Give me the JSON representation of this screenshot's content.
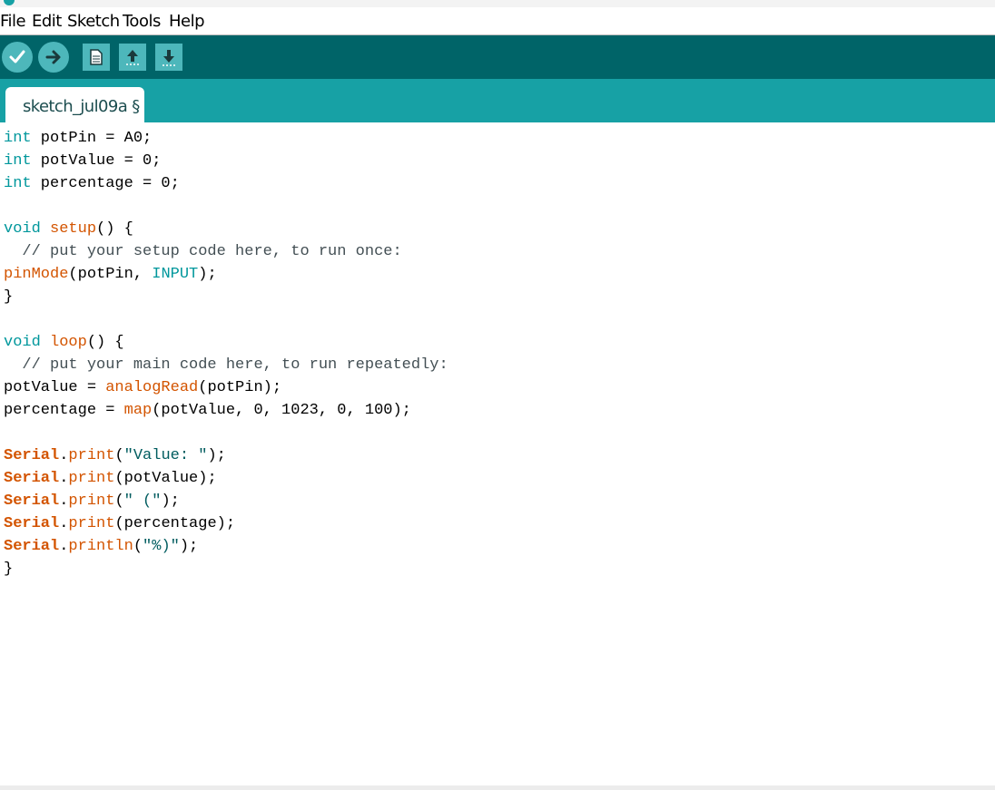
{
  "menu": {
    "items": [
      {
        "label": "File"
      },
      {
        "label": "Edit"
      },
      {
        "label": "Sketch"
      },
      {
        "label": "Tools"
      },
      {
        "label": "Help"
      }
    ]
  },
  "toolbar": {
    "buttons": [
      {
        "name": "verify",
        "icon": "check-icon"
      },
      {
        "name": "upload",
        "icon": "arrow-right-icon"
      },
      {
        "name": "new",
        "icon": "document-icon"
      },
      {
        "name": "open",
        "icon": "arrow-up-icon"
      },
      {
        "name": "save",
        "icon": "arrow-down-icon"
      }
    ]
  },
  "tab": {
    "label": "sketch_jul09a §"
  },
  "colors": {
    "toolbar_bg": "#006468",
    "tabstrip_bg": "#17a1a5",
    "button_bg": "#4db7bb",
    "keyword": "#00979c",
    "function": "#d35400",
    "comment": "#434f54"
  },
  "code": {
    "l1": [
      {
        "c": "kw",
        "t": "int"
      },
      {
        "c": "",
        "t": " potPin = A0;"
      }
    ],
    "l2": [
      {
        "c": "kw",
        "t": "int"
      },
      {
        "c": "",
        "t": " potValue = 0;"
      }
    ],
    "l3": [
      {
        "c": "kw",
        "t": "int"
      },
      {
        "c": "",
        "t": " percentage = 0;"
      }
    ],
    "l4": [
      {
        "c": "",
        "t": ""
      }
    ],
    "l5": [
      {
        "c": "kw",
        "t": "void"
      },
      {
        "c": "",
        "t": " "
      },
      {
        "c": "fn",
        "t": "setup"
      },
      {
        "c": "",
        "t": "() {"
      }
    ],
    "l6": [
      {
        "c": "cm",
        "t": "  // put your setup code here, to run once:"
      }
    ],
    "l7": [
      {
        "c": "fn",
        "t": "pinMode"
      },
      {
        "c": "",
        "t": "(potPin, "
      },
      {
        "c": "kw",
        "t": "INPUT"
      },
      {
        "c": "",
        "t": ");"
      }
    ],
    "l8": [
      {
        "c": "",
        "t": "}"
      }
    ],
    "l9": [
      {
        "c": "",
        "t": ""
      }
    ],
    "l10": [
      {
        "c": "kw",
        "t": "void"
      },
      {
        "c": "",
        "t": " "
      },
      {
        "c": "fn",
        "t": "loop"
      },
      {
        "c": "",
        "t": "() {"
      }
    ],
    "l11": [
      {
        "c": "cm",
        "t": "  // put your main code here, to run repeatedly:"
      }
    ],
    "l12": [
      {
        "c": "",
        "t": "potValue = "
      },
      {
        "c": "fn",
        "t": "analogRead"
      },
      {
        "c": "",
        "t": "(potPin);"
      }
    ],
    "l13": [
      {
        "c": "",
        "t": "percentage = "
      },
      {
        "c": "fn",
        "t": "map"
      },
      {
        "c": "",
        "t": "(potValue, 0, 1023, 0, 100);"
      }
    ],
    "l14": [
      {
        "c": "",
        "t": ""
      }
    ],
    "l15": [
      {
        "c": "ser",
        "t": "Serial"
      },
      {
        "c": "",
        "t": "."
      },
      {
        "c": "fn",
        "t": "print"
      },
      {
        "c": "",
        "t": "("
      },
      {
        "c": "str",
        "t": "\"Value: \""
      },
      {
        "c": "",
        "t": ");"
      }
    ],
    "l16": [
      {
        "c": "ser",
        "t": "Serial"
      },
      {
        "c": "",
        "t": "."
      },
      {
        "c": "fn",
        "t": "print"
      },
      {
        "c": "",
        "t": "(potValue);"
      }
    ],
    "l17": [
      {
        "c": "ser",
        "t": "Serial"
      },
      {
        "c": "",
        "t": "."
      },
      {
        "c": "fn",
        "t": "print"
      },
      {
        "c": "",
        "t": "("
      },
      {
        "c": "str",
        "t": "\" (\""
      },
      {
        "c": "",
        "t": ");"
      }
    ],
    "l18": [
      {
        "c": "ser",
        "t": "Serial"
      },
      {
        "c": "",
        "t": "."
      },
      {
        "c": "fn",
        "t": "print"
      },
      {
        "c": "",
        "t": "(percentage);"
      }
    ],
    "l19": [
      {
        "c": "ser",
        "t": "Serial"
      },
      {
        "c": "",
        "t": "."
      },
      {
        "c": "fn",
        "t": "println"
      },
      {
        "c": "",
        "t": "("
      },
      {
        "c": "str",
        "t": "\"%)\""
      },
      {
        "c": "",
        "t": ");"
      }
    ],
    "l20": [
      {
        "c": "",
        "t": "}"
      }
    ]
  }
}
